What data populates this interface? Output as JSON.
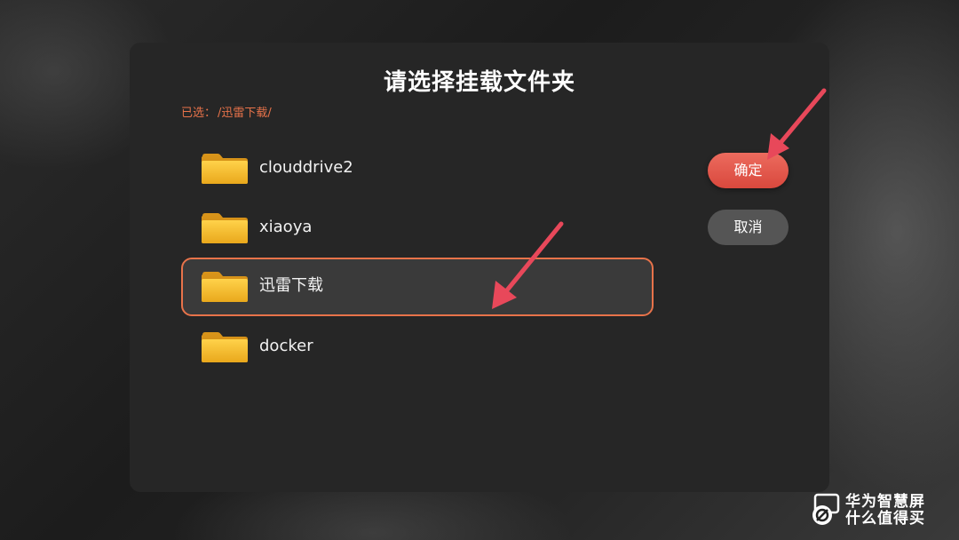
{
  "dialog": {
    "title": "请选择挂载文件夹",
    "selected_label": "已选：",
    "selected_path": "/迅雷下载/"
  },
  "folders": [
    {
      "name": "clouddrive2",
      "icon": "folder-icon",
      "selected": false
    },
    {
      "name": "xiaoya",
      "icon": "folder-icon",
      "selected": false
    },
    {
      "name": "迅雷下载",
      "icon": "folder-icon",
      "selected": true
    },
    {
      "name": "docker",
      "icon": "folder-icon",
      "selected": false
    }
  ],
  "buttons": {
    "confirm_label": "确定",
    "cancel_label": "取消"
  },
  "annotations": {
    "arrow_color": "#e8485a",
    "arrows": [
      "pointer-to-confirm-button",
      "pointer-to-selected-folder"
    ]
  },
  "watermark": {
    "line1": "华为智慧屏",
    "line2": "什么值得买"
  },
  "colors": {
    "accent": "#e8734a",
    "confirm_button": "#e05a4c",
    "cancel_button": "#555555",
    "dialog_bg": "#262626",
    "folder_yellow": "#f2b626"
  }
}
